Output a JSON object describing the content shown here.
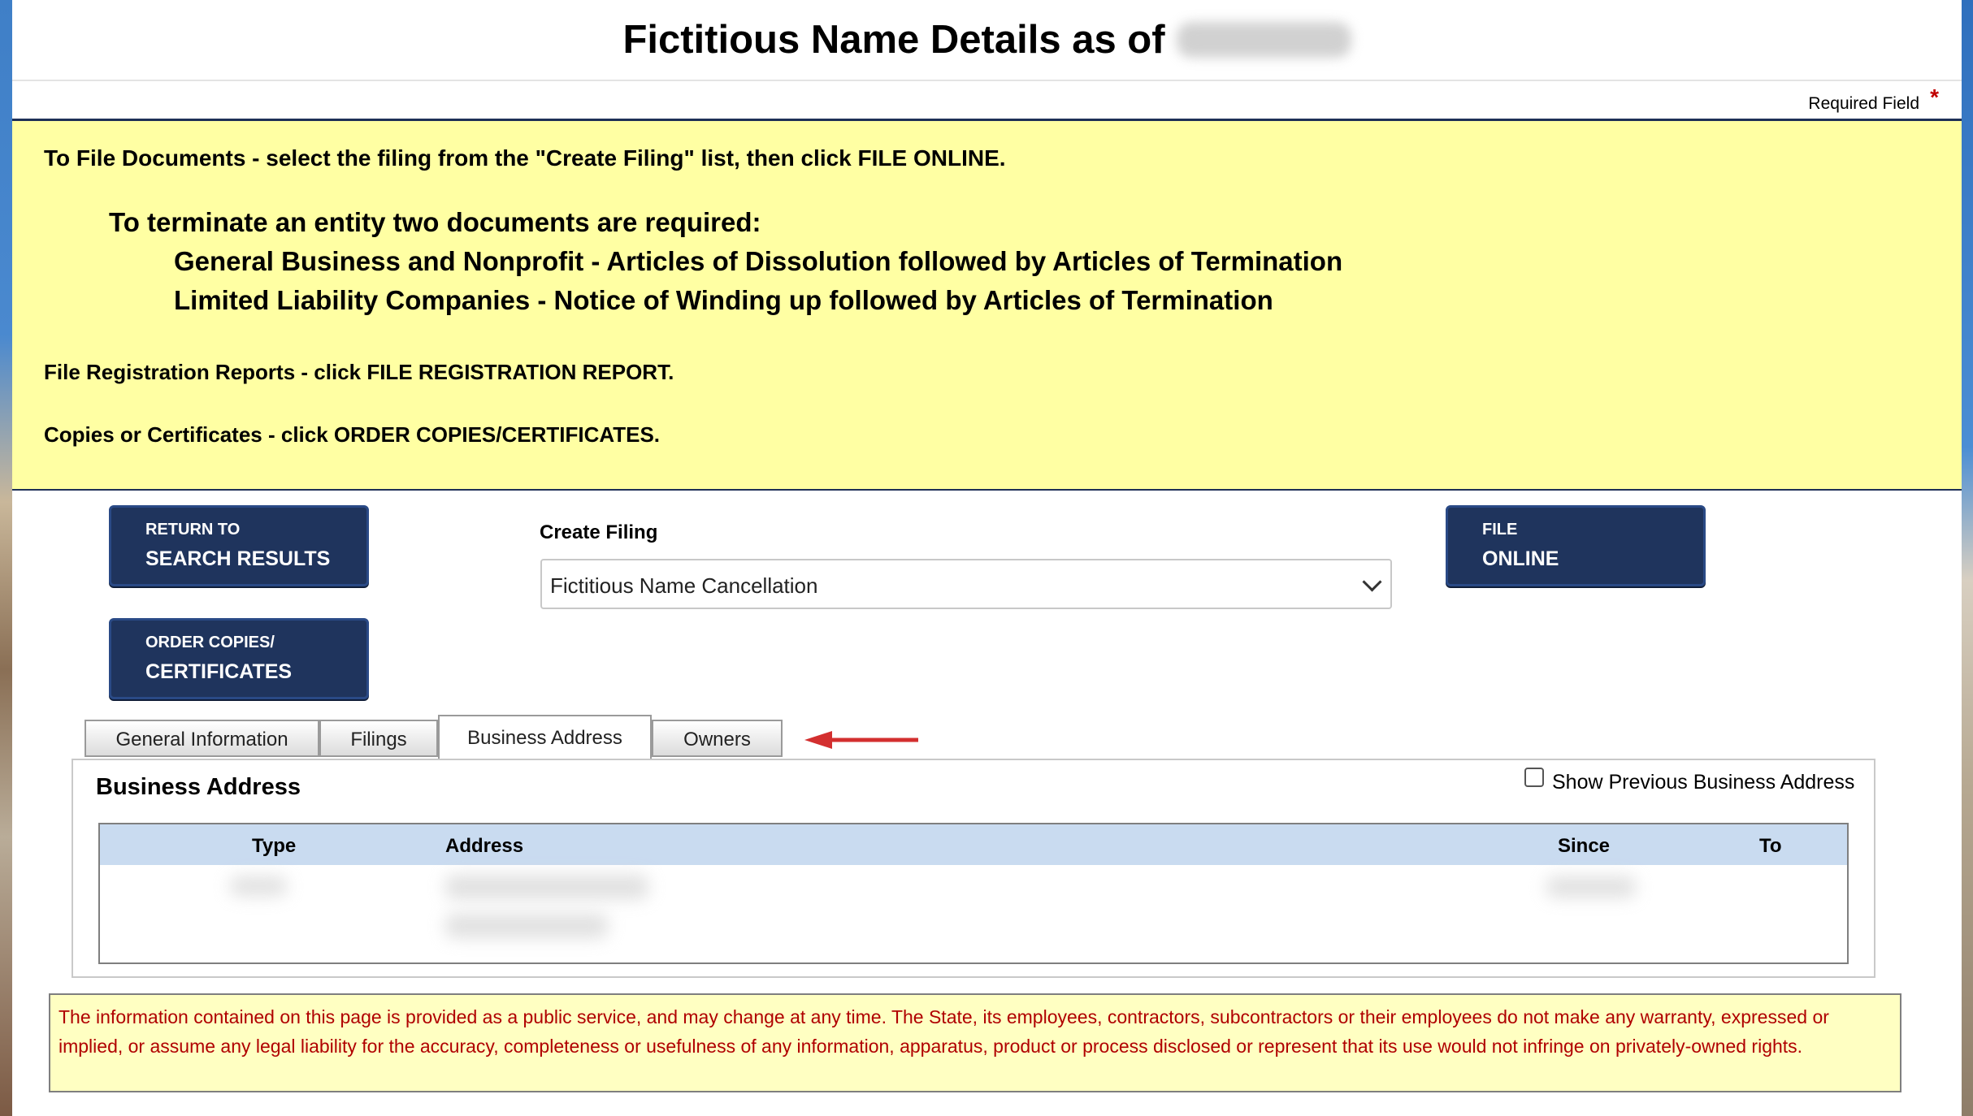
{
  "header": {
    "title": "Fictitious Name Details as of",
    "date_redacted": true,
    "required_field": "Required Field",
    "required_marker": "*"
  },
  "notice": {
    "line1": "To File Documents - select the filing from the \"Create Filing\" list, then click FILE ONLINE.",
    "terminate_heading": "To terminate an entity two documents are required:",
    "terminate_item1": "General Business and Nonprofit - Articles of Dissolution followed by Articles of Termination",
    "terminate_item2": "Limited Liability Companies - Notice of Winding up followed by Articles of Termination",
    "line_reports": "File Registration Reports - click FILE REGISTRATION REPORT.",
    "line_copies": "Copies or Certificates - click ORDER COPIES/CERTIFICATES."
  },
  "buttons": {
    "return_small": "RETURN TO",
    "return_big": "SEARCH RESULTS",
    "order_small": "ORDER COPIES/",
    "order_big": "CERTIFICATES",
    "file_small": "FILE",
    "file_big": "ONLINE"
  },
  "create_filing": {
    "label": "Create Filing",
    "selected": "Fictitious Name Cancellation"
  },
  "tabs": [
    {
      "label": "General Information",
      "active": false
    },
    {
      "label": "Filings",
      "active": false
    },
    {
      "label": "Business Address",
      "active": true
    },
    {
      "label": "Owners",
      "active": false
    }
  ],
  "panel": {
    "title": "Business Address",
    "show_previous_label": "Show Previous Business Address",
    "show_previous_checked": false,
    "columns": [
      "Type",
      "Address",
      "Since",
      "To"
    ],
    "rows_redacted": true
  },
  "disclaimer": "The information contained on this page is provided as a public service, and may change at any time. The State, its employees, contractors, subcontractors or their employees do not make any warranty, expressed or implied, or assume any legal liability for the accuracy, completeness or usefulness of any information, apparatus, product or process disclosed or represent that its use would not infringe on privately-owned rights.",
  "colors": {
    "button_bg": "#1f345d",
    "notice_bg": "#ffffa3",
    "table_header_bg": "#c9dbf0",
    "disclaimer_text": "#b00000",
    "arrow": "#d32f2f"
  },
  "icons": {
    "select_chevron": "chevron-down-icon",
    "annotation_arrow": "left-arrow-icon"
  }
}
